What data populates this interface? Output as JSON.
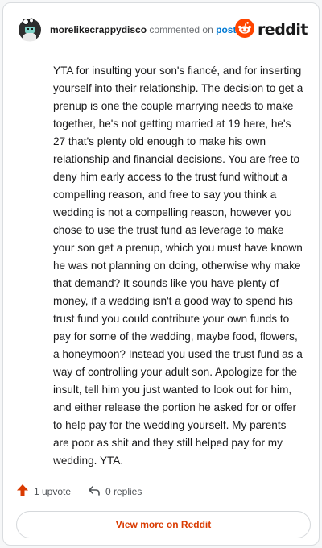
{
  "comment": {
    "username": "morelikecrappydisco",
    "commented_text": "commented on",
    "post_link": "post",
    "body": "YTA for insulting your son's fiancé, and for inserting yourself into their relationship. The decision to get a prenup is one the couple marrying needs to make together, he's not getting married at 19 here, he's 27 that's plenty old enough to make his own relationship and financial decisions. You are free to deny him early access to the trust fund without a compelling reason, and free to say you think a wedding is not a compelling reason, however you chose to use the trust fund as leverage to make your son get a prenup, which you must have known he was not planning on doing, otherwise why make that demand? It sounds like you have plenty of money, if a wedding isn't a good way to spend his trust fund you could contribute your own funds to pay for some of the wedding, maybe food, flowers, a honeymoon? Instead you used the trust fund as a way of controlling your adult son. Apologize for the insult, tell him you just wanted to look out for him, and either release the portion he asked for or offer to help pay for the wedding yourself. My parents are poor as shit and they still helped pay for my wedding. YTA."
  },
  "brand": {
    "logo_text": "reddit",
    "logo_icon": "reddit-snoo-icon",
    "color": "#ff4500"
  },
  "actions": {
    "upvote_label": "1 upvote",
    "upvote_icon": "upvote-arrow-icon",
    "replies_label": "0 replies",
    "replies_icon": "reply-arrow-icon"
  },
  "footer": {
    "view_more_label": "View more on Reddit"
  },
  "colors": {
    "username": "#1a1a1b",
    "link": "#0079d3",
    "upvote": "#d93a00",
    "view_more_text": "#d93a00"
  }
}
